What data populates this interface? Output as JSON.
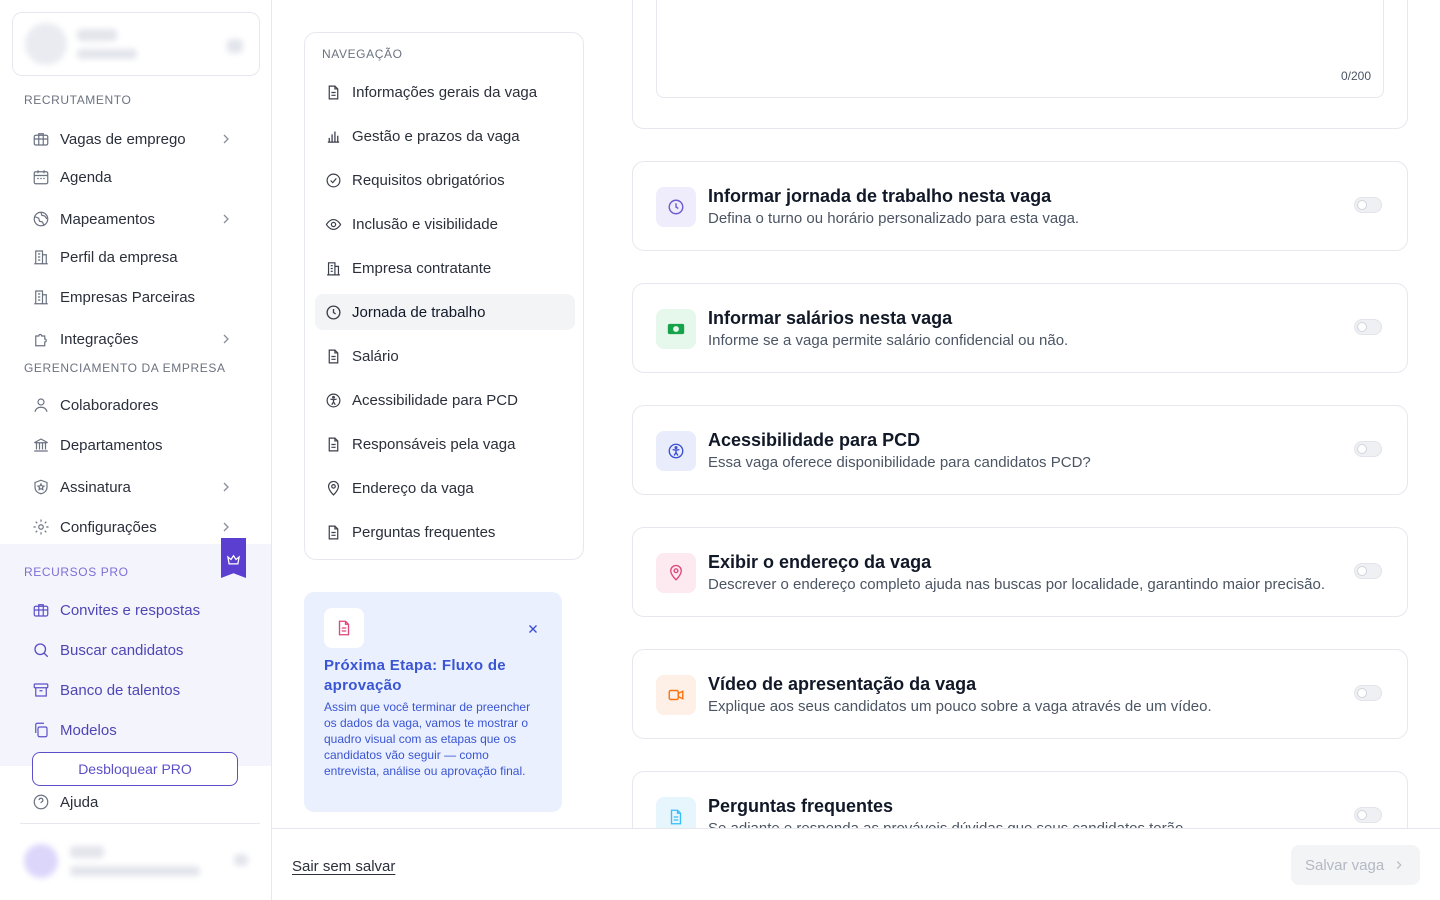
{
  "sidebar": {
    "sections": {
      "recruitment": "RECRUTAMENTO",
      "company_management": "GERENCIAMENTO DA EMPRESA",
      "pro": "RECURSOS PRO"
    },
    "recruitment_items": [
      {
        "label": "Vagas de emprego",
        "icon": "briefcase-icon",
        "chevron": true
      },
      {
        "label": "Agenda",
        "icon": "calendar-icon",
        "chevron": false
      },
      {
        "label": "Mapeamentos",
        "icon": "globe-icon",
        "chevron": true
      },
      {
        "label": "Perfil da empresa",
        "icon": "building-icon",
        "chevron": false
      },
      {
        "label": "Empresas Parceiras",
        "icon": "building-icon",
        "chevron": false
      },
      {
        "label": "Integrações",
        "icon": "puzzle-icon",
        "chevron": true
      }
    ],
    "management_items": [
      {
        "label": "Colaboradores",
        "icon": "user-icon",
        "chevron": false
      },
      {
        "label": "Departamentos",
        "icon": "bank-icon",
        "chevron": false
      },
      {
        "label": "Assinatura",
        "icon": "shield-icon",
        "chevron": true
      },
      {
        "label": "Configurações",
        "icon": "gear-icon",
        "chevron": true
      }
    ],
    "pro_items": [
      {
        "label": "Convites e respostas",
        "icon": "briefcase-icon"
      },
      {
        "label": "Buscar candidatos",
        "icon": "search-icon"
      },
      {
        "label": "Banco de talentos",
        "icon": "archive-icon"
      },
      {
        "label": "Modelos",
        "icon": "copy-icon"
      }
    ],
    "pro_button_label": "Desbloquear PRO",
    "help_label": "Ajuda"
  },
  "steps_nav": {
    "title": "NAVEGAÇÃO",
    "items": [
      {
        "label": "Informações gerais da vaga",
        "icon": "document-icon"
      },
      {
        "label": "Gestão e prazos da vaga",
        "icon": "bar-chart-icon"
      },
      {
        "label": "Requisitos obrigatórios",
        "icon": "check-circle-icon"
      },
      {
        "label": "Inclusão e visibilidade",
        "icon": "eye-icon"
      },
      {
        "label": "Empresa contratante",
        "icon": "building-icon"
      },
      {
        "label": "Jornada de trabalho",
        "icon": "clock-icon",
        "active": true
      },
      {
        "label": "Salário",
        "icon": "document-icon"
      },
      {
        "label": "Acessibilidade para PCD",
        "icon": "accessibility-icon"
      },
      {
        "label": "Responsáveis pela vaga",
        "icon": "document-icon"
      },
      {
        "label": "Endereço da vaga",
        "icon": "map-pin-icon"
      },
      {
        "label": "Perguntas frequentes",
        "icon": "document-icon"
      }
    ]
  },
  "next_step_card": {
    "title": "Próxima Etapa: Fluxo de aprovação",
    "body": "Assim que você terminar de preencher os dados da vaga, vamos te mostrar o quadro visual com as etapas que os candidatos vão seguir — como entrevista, análise ou aprovação final.",
    "icon": "document-icon",
    "close_icon": "close-icon"
  },
  "description_field": {
    "counter": "0/200"
  },
  "options": [
    {
      "title": "Informar jornada de trabalho nesta vaga",
      "desc": "Defina o turno ou horário personalizado para esta vaga.",
      "icon": "clock-icon",
      "color": "#6d5bd0",
      "bg": "#efedfb",
      "enabled": false
    },
    {
      "title": "Informar salários nesta vaga",
      "desc": "Informe se a vaga permite salário confidencial ou não.",
      "icon": "money-icon",
      "color": "#16a34a",
      "bg": "#e6f7ec",
      "enabled": false
    },
    {
      "title": "Acessibilidade para PCD",
      "desc": "Essa vaga oferece disponibilidade para candidatos PCD?",
      "icon": "accessibility-icon",
      "color": "#3b4fd1",
      "bg": "#e8ecfb",
      "enabled": false
    },
    {
      "title": "Exibir o endereço da vaga",
      "desc": "Descrever o endereço completo ajuda nas buscas por localidade, garantindo maior precisão.",
      "icon": "map-pin-icon",
      "color": "#e0457b",
      "bg": "#fde9f0",
      "enabled": false
    },
    {
      "title": "Vídeo de apresentação da vaga",
      "desc": "Explique aos seus candidatos um pouco sobre a vaga através de um vídeo.",
      "icon": "video-icon",
      "color": "#f97316",
      "bg": "#fef0e6",
      "enabled": false
    },
    {
      "title": "Perguntas frequentes",
      "desc": "Se adiante e responda as prováveis dúvidas que seus candidatos terão.",
      "icon": "document-icon",
      "color": "#38bdf8",
      "bg": "#e7f5fd",
      "enabled": false
    }
  ],
  "footer": {
    "exit_label": "Sair sem salvar",
    "save_label": "Salvar vaga"
  }
}
